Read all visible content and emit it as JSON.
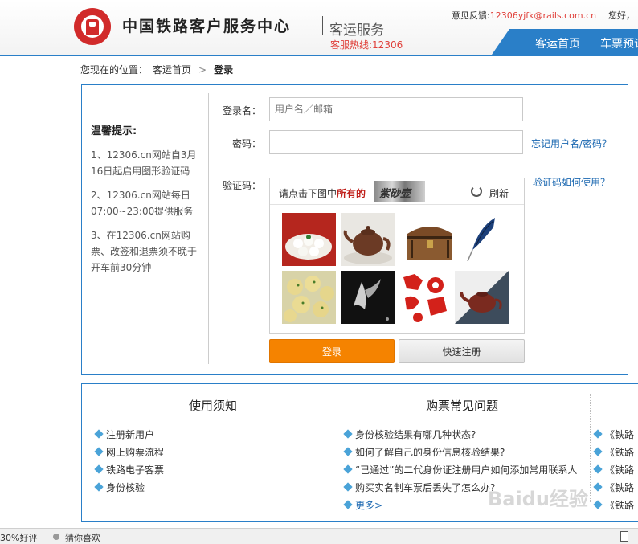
{
  "header": {
    "site_title": "中国铁路客户服务中心",
    "site_subtitle": "客运服务",
    "hotline": "客服热线:12306",
    "feedback_label": "意见反馈:",
    "feedback_email": "12306yjfk@rails.com.cn",
    "greeting": "您好，",
    "nav": {
      "home": "客运首页",
      "ticket": "车票预订"
    }
  },
  "breadcrumb": {
    "prefix": "您现在的位置：",
    "home": "客运首页",
    "separator": ">",
    "current": "登录"
  },
  "tips": {
    "title": "温馨提示:",
    "items": [
      "1、12306.cn网站自3月16日起启用图形验证码",
      "2、12306.cn网站每日07:00~23:00提供服务",
      "3、在12306.cn网站购票、改签和退票须不晚于开车前30分钟"
    ]
  },
  "login": {
    "username_label": "登录名：",
    "username_placeholder": "用户名／邮箱",
    "password_label": "密码：",
    "forgot_link": "忘记用户名/密码？",
    "captcha_label": "验证码：",
    "captcha_help": "验证码如何使用？",
    "captcha": {
      "prompt": "请点击下图中",
      "emphasis": "所有的",
      "word": "紫砂壶",
      "refresh": "刷新",
      "images": [
        "dumplings",
        "teapot",
        "wooden-chest",
        "feather",
        "meatballs",
        "bat",
        "paper-cuts",
        "teapot"
      ]
    },
    "login_button": "登录",
    "register_button": "快速注册"
  },
  "info": {
    "col1": {
      "title": "使用须知",
      "items": [
        "注册新用户",
        "网上购票流程",
        "铁路电子客票",
        "身份核验"
      ]
    },
    "col2": {
      "title": "购票常见问题",
      "items": [
        "身份核验结果有哪几种状态?",
        "如何了解自己的身份信息核验结果?",
        "“已通过”的二代身份证注册用户如何添加常用联系人",
        "购买实名制车票后丢失了怎么办?"
      ],
      "more": "更多>"
    },
    "col3": {
      "items": [
        "《铁路",
        "《铁路",
        "《铁路",
        "《铁路",
        "《铁路"
      ]
    }
  },
  "watermark": "Baidu经验",
  "status_bar": {
    "rate": "30%好评",
    "guess": "猜你喜欢"
  },
  "colors": {
    "accent": "#2a7fc8",
    "login_button": "#f58300",
    "highlight": "#c0201b"
  }
}
